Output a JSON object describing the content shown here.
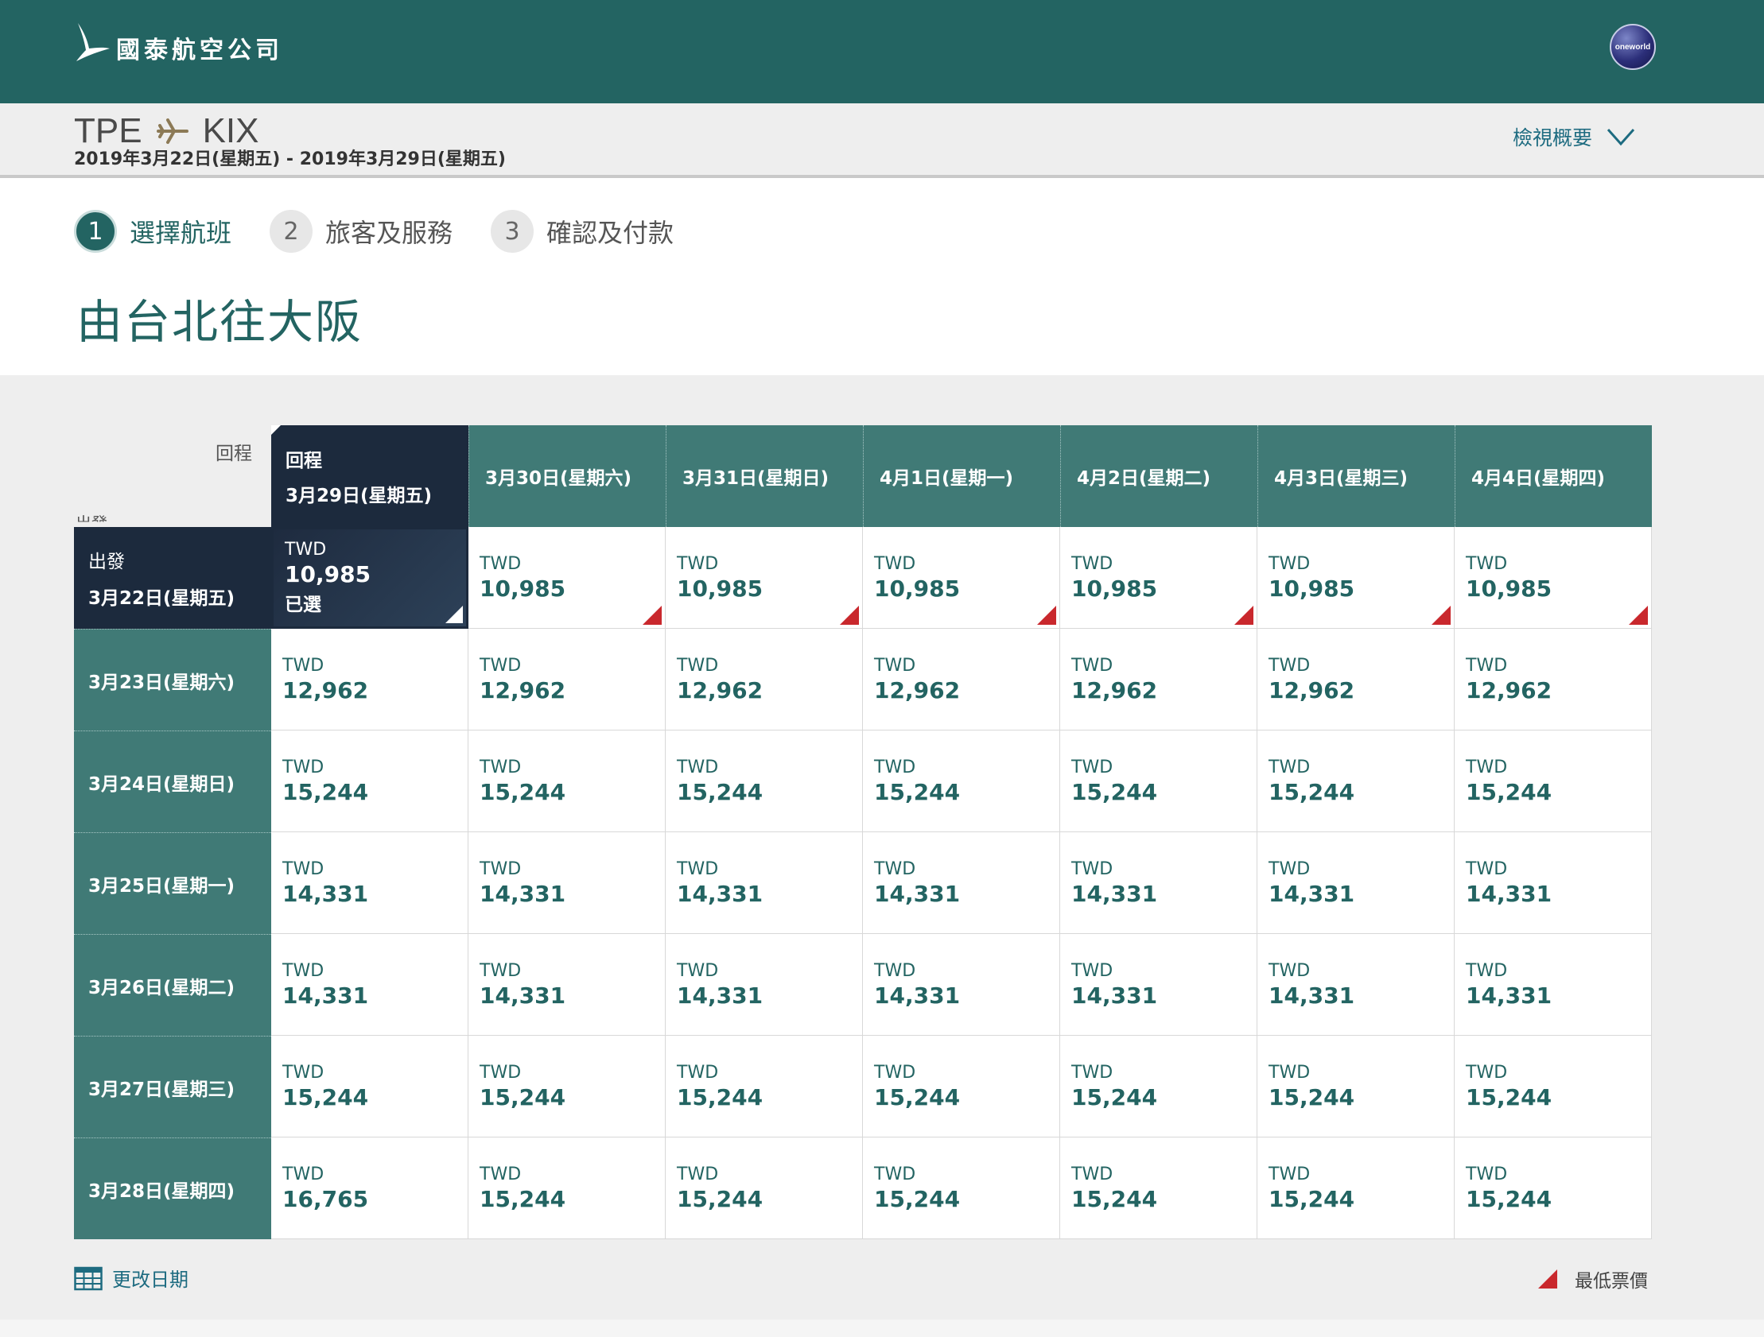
{
  "header": {
    "airline": "國泰航空公司",
    "alliance_badge": "oneworld",
    "colors": {
      "brand": "#236462",
      "selected": "#1c2a3d",
      "lowest_fare": "#c9282d"
    }
  },
  "summary": {
    "origin": "TPE",
    "destination": "KIX",
    "dates": "2019年3月22日(星期五) - 2019年3月29日(星期五)",
    "view_summary": "檢視概要"
  },
  "steps": [
    {
      "num": "1",
      "label": "選擇航班"
    },
    {
      "num": "2",
      "label": "旅客及服務"
    },
    {
      "num": "3",
      "label": "確認及付款"
    }
  ],
  "page_title": "由台北往大阪",
  "grid": {
    "corner_return": "回程",
    "corner_depart": "出發",
    "selected_return_label": "回程",
    "selected_depart_label": "出發",
    "return_dates": [
      "3月29日(星期五)",
      "3月30日(星期六)",
      "3月31日(星期日)",
      "4月1日(星期一)",
      "4月2日(星期二)",
      "4月3日(星期三)",
      "4月4日(星期四)"
    ],
    "depart_dates": [
      "3月22日(星期五)",
      "3月23日(星期六)",
      "3月24日(星期日)",
      "3月25日(星期一)",
      "3月26日(星期二)",
      "3月27日(星期三)",
      "3月28日(星期四)"
    ],
    "currency": "TWD",
    "selected_text": "已選",
    "selected_cell": [
      0,
      0
    ],
    "prices": [
      [
        "10,985",
        "10,985",
        "10,985",
        "10,985",
        "10,985",
        "10,985",
        "10,985"
      ],
      [
        "12,962",
        "12,962",
        "12,962",
        "12,962",
        "12,962",
        "12,962",
        "12,962"
      ],
      [
        "15,244",
        "15,244",
        "15,244",
        "15,244",
        "15,244",
        "15,244",
        "15,244"
      ],
      [
        "14,331",
        "14,331",
        "14,331",
        "14,331",
        "14,331",
        "14,331",
        "14,331"
      ],
      [
        "14,331",
        "14,331",
        "14,331",
        "14,331",
        "14,331",
        "14,331",
        "14,331"
      ],
      [
        "15,244",
        "15,244",
        "15,244",
        "15,244",
        "15,244",
        "15,244",
        "15,244"
      ],
      [
        "16,765",
        "15,244",
        "15,244",
        "15,244",
        "15,244",
        "15,244",
        "15,244"
      ]
    ],
    "lowest_fare_cells": [
      [
        0,
        1
      ],
      [
        0,
        2
      ],
      [
        0,
        3
      ],
      [
        0,
        4
      ],
      [
        0,
        5
      ],
      [
        0,
        6
      ]
    ]
  },
  "footer": {
    "change_date": "更改日期",
    "legend_lowest": "最低票價"
  }
}
